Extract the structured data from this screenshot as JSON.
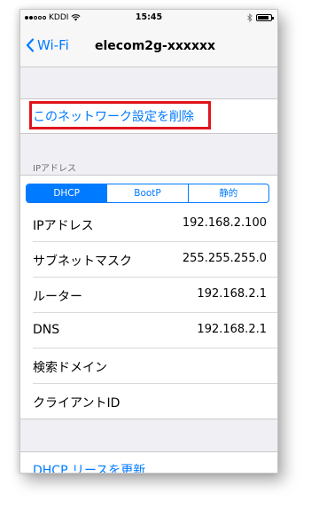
{
  "status_bar": {
    "carrier": "KDDI",
    "time": "15:45",
    "signal_filled": 2,
    "signal_total": 5,
    "battery_level": 0.85
  },
  "nav": {
    "back_label": "Wi-Fi",
    "title": "elecom2g-xxxxxx"
  },
  "forget": {
    "label": "このネットワーク設定を削除"
  },
  "ip_section": {
    "header": "IPアドレス",
    "segments": [
      "DHCP",
      "BootP",
      "静的"
    ],
    "selected_segment": "DHCP"
  },
  "rows": [
    {
      "label": "IPアドレス",
      "value": "192.168.2.100"
    },
    {
      "label": "サブネットマスク",
      "value": "255.255.255.0"
    },
    {
      "label": "ルーター",
      "value": "192.168.2.1"
    },
    {
      "label": "DNS",
      "value": "192.168.2.1"
    },
    {
      "label": "検索ドメイン",
      "value": ""
    },
    {
      "label": "クライアントID",
      "value": ""
    }
  ],
  "renew": {
    "label": "DHCP リースを更新"
  },
  "colors": {
    "accent": "#007aff",
    "highlight_box": "#e0141b",
    "background": "#efeff4"
  }
}
